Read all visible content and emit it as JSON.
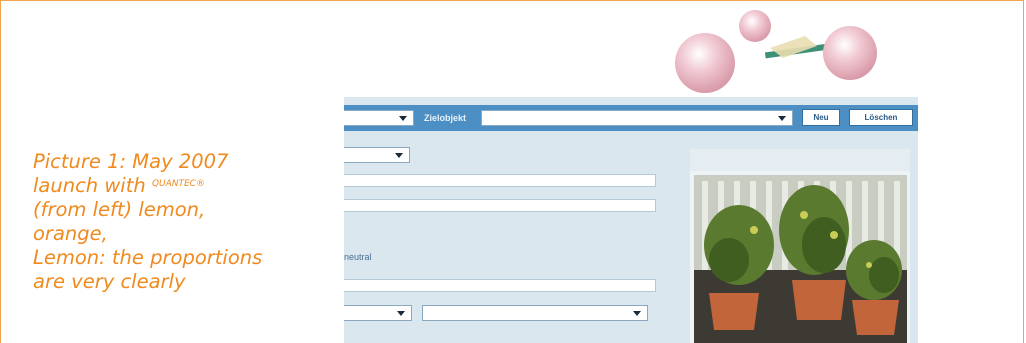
{
  "caption": {
    "line1": "Picture 1: May 2007",
    "line2_prefix": "launch with ",
    "line2_sup": "QUANTEC®",
    "line3": "(from left) lemon,",
    "line4": "orange,",
    "line5": "Lemon: the proportions",
    "line6": "are very clearly"
  },
  "toolbar": {
    "target_label": "Zielobjekt",
    "new_label": "Neu",
    "delete_label": "Löschen"
  },
  "form": {
    "neutral_text": "neutral"
  },
  "colors": {
    "accent_orange": "#f08a1e",
    "toolbar_blue": "#4c8fc4",
    "panel_bg": "#dbe7ee"
  }
}
